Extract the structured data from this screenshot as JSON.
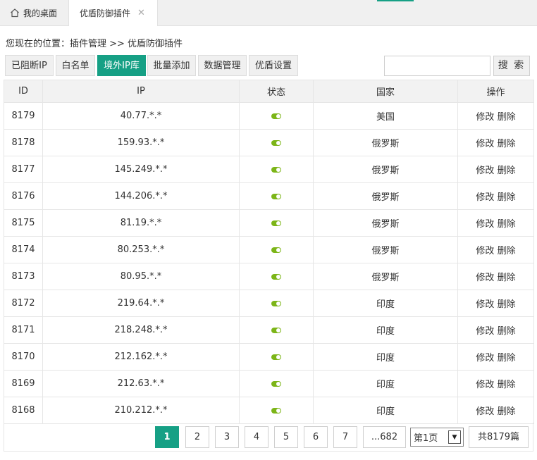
{
  "tabs": {
    "home_label": "我的桌面",
    "active_label": "优盾防御插件",
    "close_glyph": "✕"
  },
  "breadcrumb": "您现在的位置：插件管理 >> 优盾防御插件",
  "toolbar": {
    "buttons": [
      "已阻断IP",
      "白名单",
      "境外IP库",
      "批量添加",
      "数据管理",
      "优盾设置"
    ],
    "active_index": 2,
    "search_placeholder": "",
    "search_label": "搜 索"
  },
  "table": {
    "headers": [
      "ID",
      "IP",
      "状态",
      "国家",
      "操作"
    ],
    "rows": [
      {
        "id": "8179",
        "ip": "40.77.*.*",
        "status": "on",
        "country": "美国"
      },
      {
        "id": "8178",
        "ip": "159.93.*.*",
        "status": "on",
        "country": "俄罗斯"
      },
      {
        "id": "8177",
        "ip": "145.249.*.*",
        "status": "on",
        "country": "俄罗斯"
      },
      {
        "id": "8176",
        "ip": "144.206.*.*",
        "status": "on",
        "country": "俄罗斯"
      },
      {
        "id": "8175",
        "ip": "81.19.*.*",
        "status": "on",
        "country": "俄罗斯"
      },
      {
        "id": "8174",
        "ip": "80.253.*.*",
        "status": "on",
        "country": "俄罗斯"
      },
      {
        "id": "8173",
        "ip": "80.95.*.*",
        "status": "on",
        "country": "俄罗斯"
      },
      {
        "id": "8172",
        "ip": "219.64.*.*",
        "status": "on",
        "country": "印度"
      },
      {
        "id": "8171",
        "ip": "218.248.*.*",
        "status": "on",
        "country": "印度"
      },
      {
        "id": "8170",
        "ip": "212.162.*.*",
        "status": "on",
        "country": "印度"
      },
      {
        "id": "8169",
        "ip": "212.63.*.*",
        "status": "on",
        "country": "印度"
      },
      {
        "id": "8168",
        "ip": "210.212.*.*",
        "status": "on",
        "country": "印度"
      }
    ],
    "edit_label": "修改",
    "delete_label": "删除"
  },
  "pagination": {
    "pages": [
      "1",
      "2",
      "3",
      "4",
      "5",
      "6",
      "7",
      "...682"
    ],
    "current": "1",
    "select_value": "第1页",
    "total_label": "共8179篇"
  },
  "colors": {
    "accent": "#16a085",
    "toggle_on": "#7cb518"
  }
}
